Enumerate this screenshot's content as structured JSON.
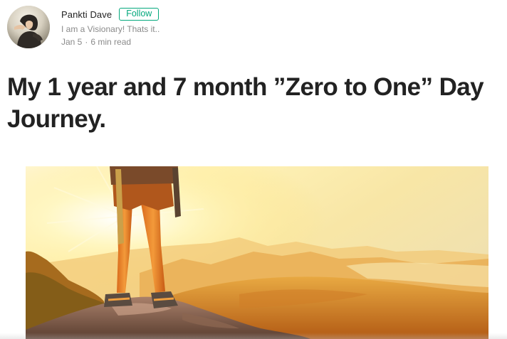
{
  "author": {
    "name": "Pankti Dave",
    "follow_label": "Follow",
    "bio": "I am a Visionary! Thats it..",
    "date": "Jan 5",
    "separator": "·",
    "read_time": "6 min read"
  },
  "post": {
    "title": "My 1 year and 7 month ”Zero to One” Day Journey."
  },
  "colors": {
    "follow_accent": "#03a87c",
    "title": "#222222",
    "meta": "#8a8a8a"
  },
  "icons": {
    "avatar": "author-avatar-photo",
    "hero": "hiker-on-mountain-sunrise-image"
  }
}
